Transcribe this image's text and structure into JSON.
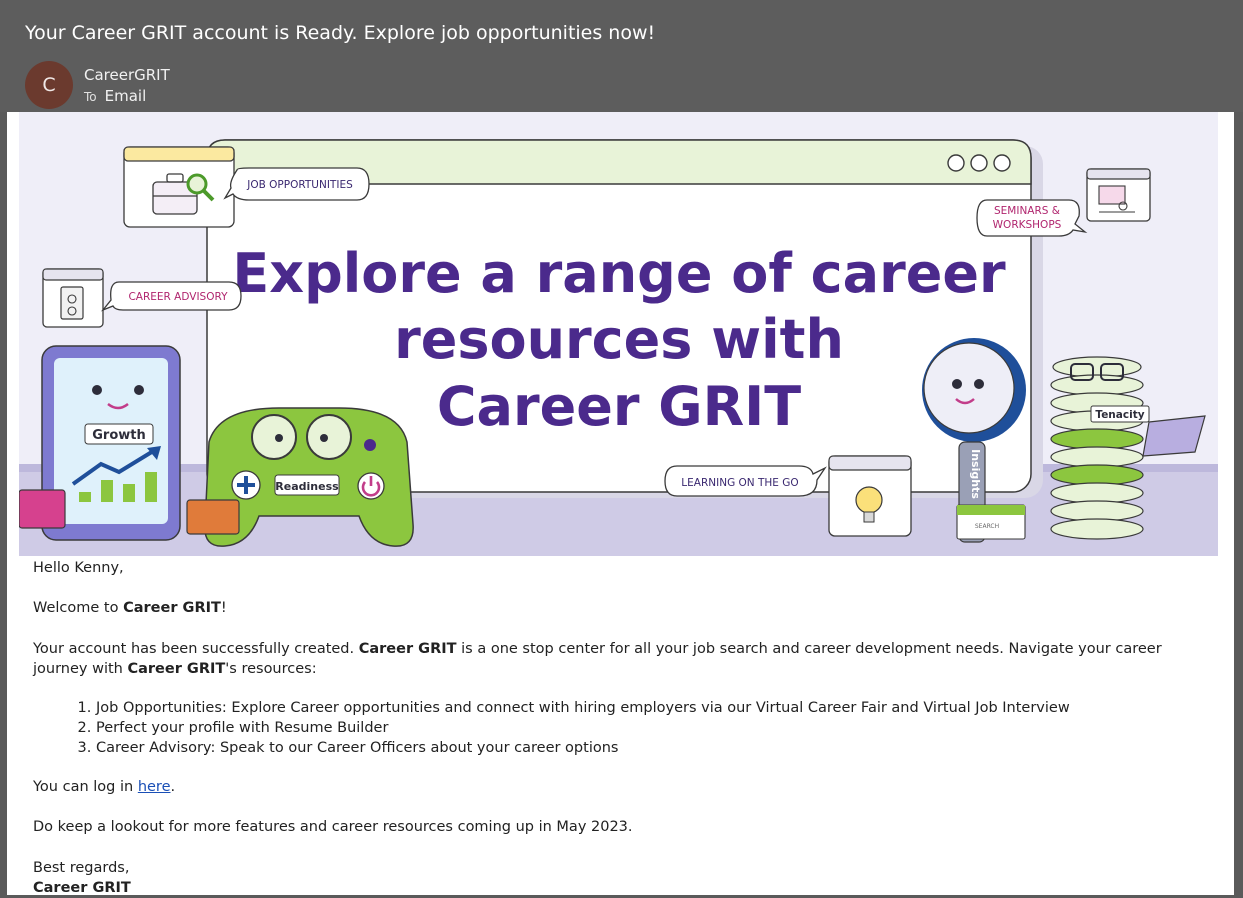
{
  "email": {
    "subject": "Your Career GRIT account is Ready. Explore job opportunities now!",
    "avatar_letter": "C",
    "sender": "CareerGRIT",
    "to_label": "To",
    "to_value": "Email"
  },
  "banner": {
    "headline_1": "Explore a range of career",
    "headline_2": "resources with",
    "headline_3": "Career GRIT",
    "tag_job": "JOB OPPORTUNITIES",
    "tag_advisory": "CAREER ADVISORY",
    "tag_seminars_1": "SEMINARS &",
    "tag_seminars_2": "WORKSHOPS",
    "tag_learning": "LEARNING ON THE GO",
    "label_growth": "Growth",
    "label_readiness": "Readiness",
    "label_insights": "Insights",
    "label_tenacity": "Tenacity",
    "label_search": "SEARCH",
    "colors": {
      "purple": "#4b2a8c",
      "green": "#8cc63f",
      "magenta": "#b0256e"
    }
  },
  "message": {
    "greeting": "Hello Kenny,",
    "welcome_prefix": "Welcome to ",
    "welcome_brand": "Career GRIT",
    "welcome_suffix": "!",
    "intro_1": "Your account has been successfully created. ",
    "intro_brand_1": "Career GRIT",
    "intro_2": " is a one stop center for all your job search and career development needs. Navigate your career journey with ",
    "intro_brand_2": "Career GRIT",
    "intro_3": "'s resources:",
    "list": [
      "Job Opportunities: Explore Career opportunities and connect with hiring employers via our Virtual Career Fair and Virtual Job Interview",
      "Perfect your profile with Resume Builder",
      "Career Advisory: Speak to our Career Officers about your career options"
    ],
    "login_prefix": "You can log in ",
    "login_link": "here",
    "login_suffix": ".",
    "lookout": "Do keep a lookout for more features and career resources coming up in May 2023.",
    "regards": "Best regards,",
    "signature": "Career GRIT"
  }
}
